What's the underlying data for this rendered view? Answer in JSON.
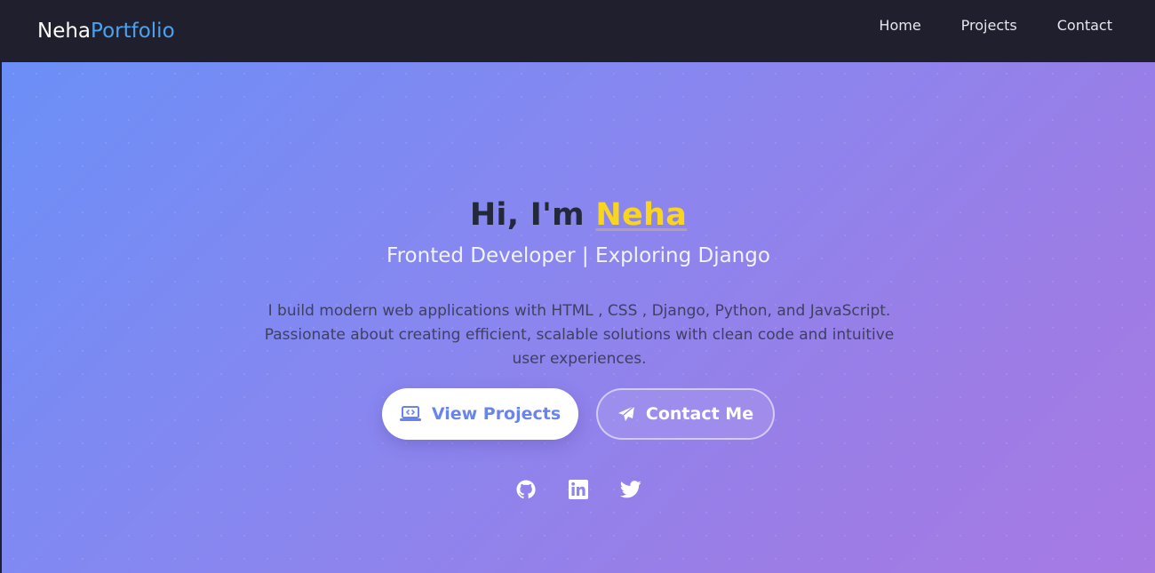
{
  "navbar": {
    "brand_primary": "Neha",
    "brand_accent": "Portfolio",
    "links": [
      {
        "label": "Home"
      },
      {
        "label": "Projects"
      },
      {
        "label": "Contact"
      }
    ]
  },
  "hero": {
    "greeting": "Hi, I'm ",
    "name": "Neha",
    "subtitle": "Fronted Developer | Exploring Django",
    "description": "I build modern web applications with HTML , CSS , Django, Python, and JavaScript. Passionate about creating efficient, scalable solutions with clean code and intuitive user experiences.",
    "buttons": {
      "primary_label": "View Projects",
      "primary_icon": "laptop-code-icon",
      "secondary_label": "Contact Me",
      "secondary_icon": "paper-plane-icon"
    },
    "socials": [
      {
        "icon": "github-icon"
      },
      {
        "icon": "linkedin-icon"
      },
      {
        "icon": "twitter-icon"
      }
    ]
  },
  "colors": {
    "navbar_bg": "#1f1f2e",
    "brand_accent": "#4aa3f0",
    "name_highlight": "#f9d51f",
    "gradient_start": "#6b8ff7",
    "gradient_end": "#a77ae3",
    "primary_button_text": "#6a84ee"
  }
}
